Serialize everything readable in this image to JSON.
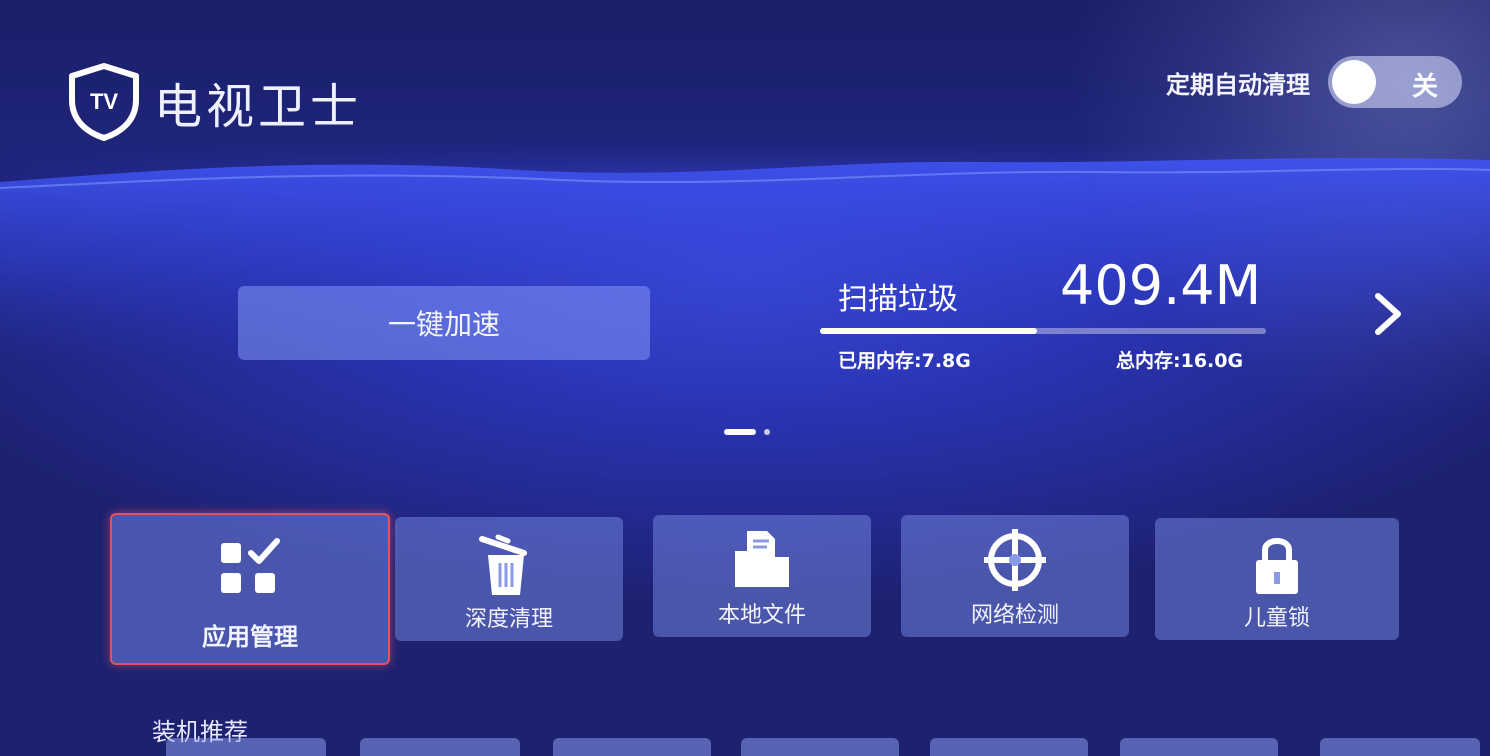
{
  "app": {
    "title": "电视卫士",
    "logo_text": "TV"
  },
  "auto_clean": {
    "label": "定期自动清理",
    "state": "关"
  },
  "boost_button": {
    "label": "一键加速"
  },
  "memory": {
    "scan_label": "扫描垃圾",
    "scan_size": "409.4M",
    "used": "已用内存:7.8G",
    "total": "总内存:16.0G",
    "usage_fraction": 0.4875
  },
  "pager": {
    "pages": 2,
    "active": 0
  },
  "tools": [
    {
      "label": "应用管理",
      "icon": "app-manage-icon",
      "focused": true
    },
    {
      "label": "深度清理",
      "icon": "trash-icon",
      "focused": false
    },
    {
      "label": "本地文件",
      "icon": "folder-file-icon",
      "focused": false
    },
    {
      "label": "网络检测",
      "icon": "network-crosshair-icon",
      "focused": false
    },
    {
      "label": "儿童锁",
      "icon": "lock-icon",
      "focused": false
    }
  ],
  "recommend": {
    "title": "装机推荐"
  },
  "colors": {
    "background": "#2b35b6",
    "focus_border": "#e8505c",
    "tile_bg": "rgba(130,150,240,0.45)"
  }
}
